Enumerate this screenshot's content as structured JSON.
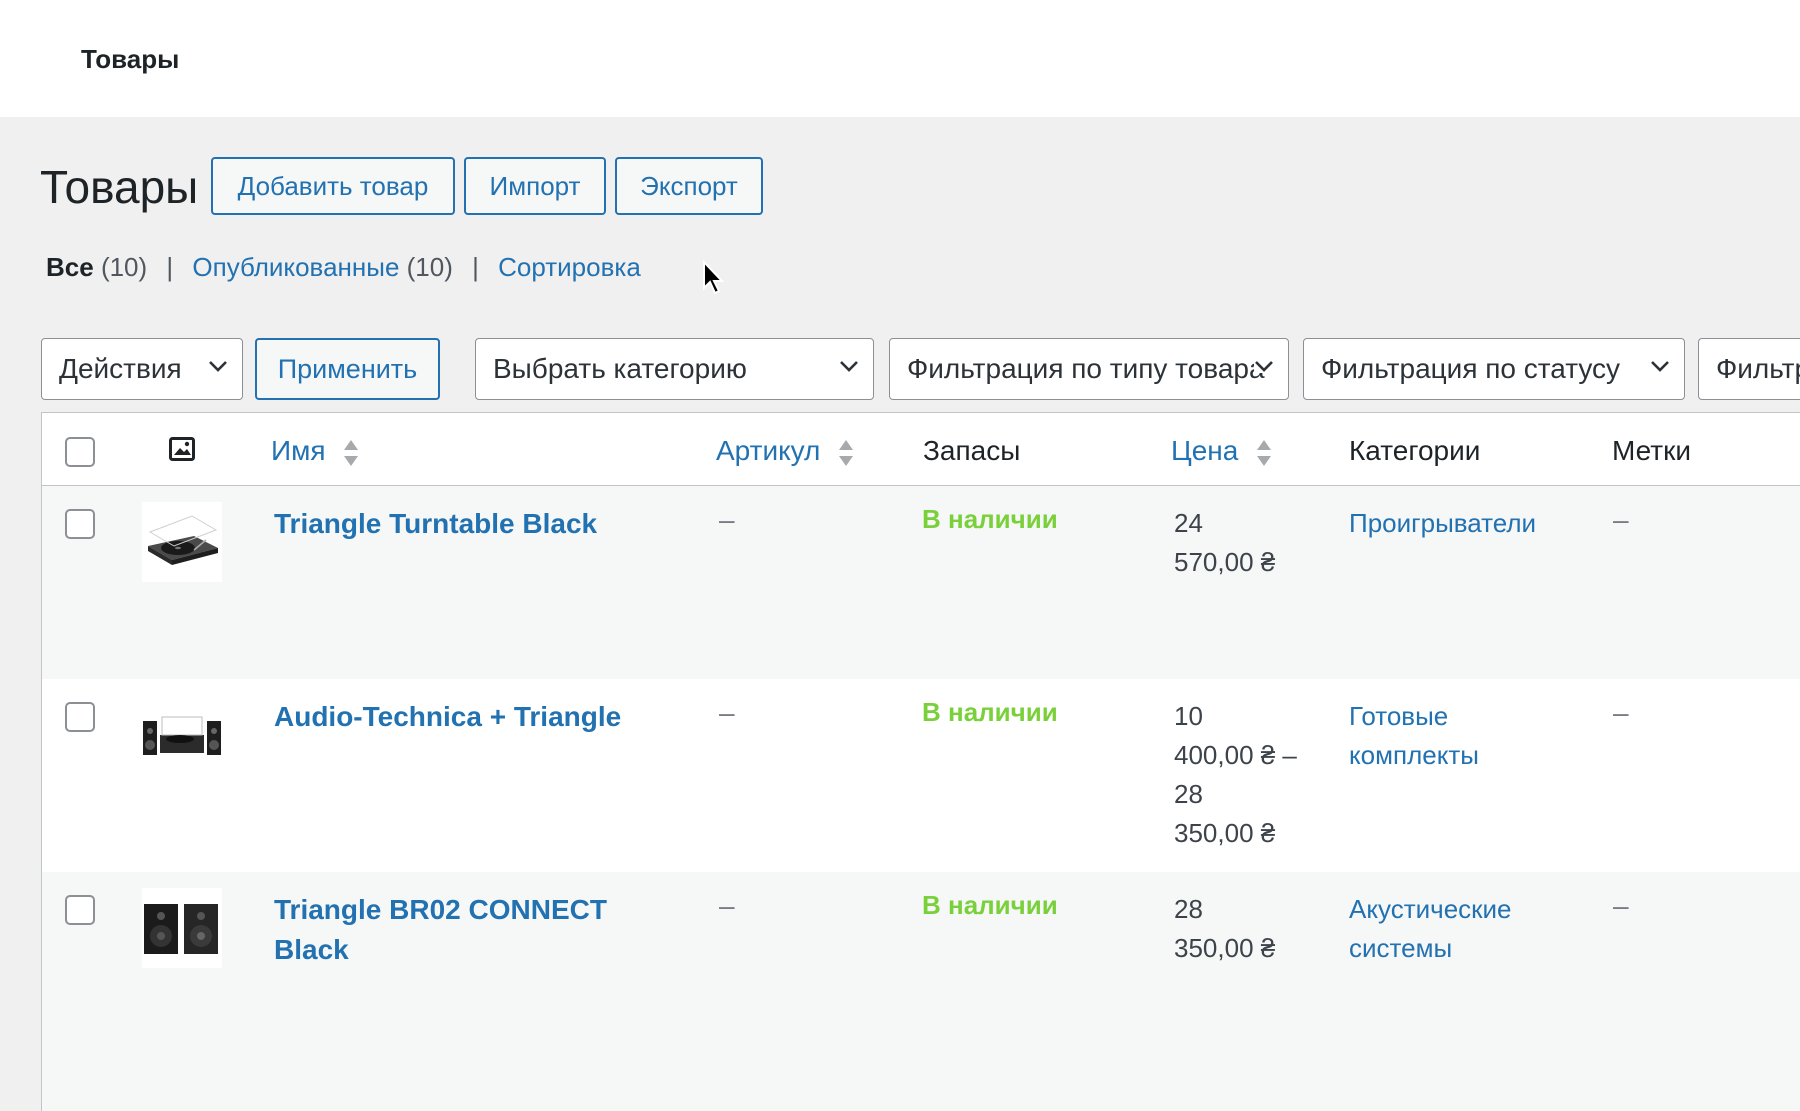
{
  "topbar": {
    "title": "Товары"
  },
  "page": {
    "title": "Товары",
    "buttons": {
      "add": "Добавить товар",
      "import": "Импорт",
      "export": "Экспорт"
    }
  },
  "views": {
    "all_label": "Все",
    "all_count": "(10)",
    "published_label": "Опубликованные",
    "published_count": "(10)",
    "sorting_label": "Сортировка",
    "separator": "|"
  },
  "filters": {
    "bulk_actions": "Действия",
    "apply": "Применить",
    "category": "Выбрать категорию",
    "product_type": "Фильтрация по типу товара",
    "stock_status": "Фильтрация по статусу",
    "extra": "Фильтрация"
  },
  "columns": {
    "name": "Имя",
    "sku": "Артикул",
    "stock": "Запасы",
    "price": "Цена",
    "categories": "Категории",
    "tags": "Метки"
  },
  "products": [
    {
      "name": "Triangle Turntable Black",
      "sku": "–",
      "stock": "В наличии",
      "price_lines": [
        "24",
        "570,00 ₴"
      ],
      "category_lines": [
        "Проигрыватели"
      ],
      "tags": "–",
      "thumb_icon": "turntable-icon"
    },
    {
      "name": "Audio-Technica + Triangle",
      "sku": "–",
      "stock": "В наличии",
      "price_lines": [
        "10",
        "400,00 ₴ –",
        "28",
        "350,00 ₴"
      ],
      "category_lines": [
        "Готовые",
        "комплекты"
      ],
      "tags": "–",
      "thumb_icon": "audio-set-icon"
    },
    {
      "name": "Triangle BR02 CONNECT Black",
      "sku": "–",
      "stock": "В наличии",
      "price_lines": [
        "28",
        "350,00 ₴"
      ],
      "category_lines": [
        "Акустические",
        "системы"
      ],
      "tags": "–",
      "thumb_icon": "speakers-icon"
    }
  ],
  "colors": {
    "link": "#2271b1",
    "in_stock": "#7ad03a",
    "text": "#1d2327"
  }
}
